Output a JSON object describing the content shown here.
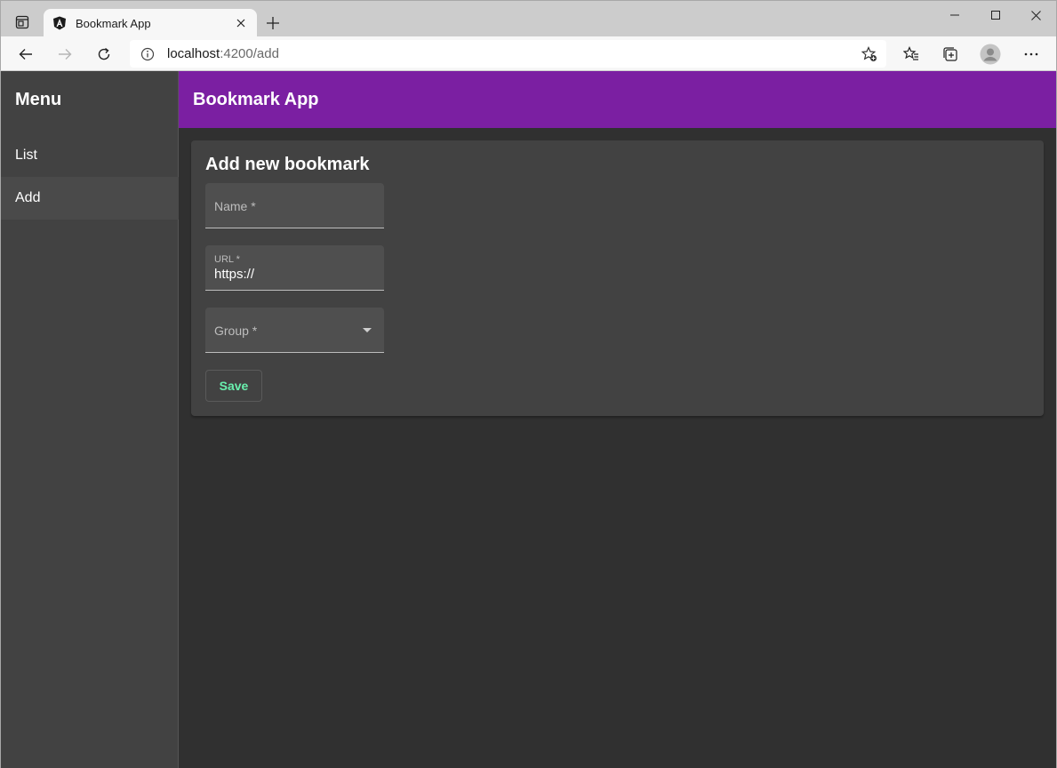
{
  "browser": {
    "tab_title": "Bookmark App",
    "url_host": "localhost",
    "url_path": ":4200/add"
  },
  "sidenav": {
    "title": "Menu",
    "items": [
      {
        "label": "List",
        "active": false
      },
      {
        "label": "Add",
        "active": true
      }
    ]
  },
  "toolbar": {
    "title": "Bookmark App"
  },
  "form": {
    "title": "Add new bookmark",
    "name_label": "Name *",
    "name_value": "",
    "url_label": "URL *",
    "url_value": "https://",
    "group_label": "Group *",
    "save_label": "Save"
  },
  "colors": {
    "toolbar": "#7b1fa2",
    "accent": "#69f0ae",
    "card": "#424242",
    "background": "#303030"
  },
  "icons": [
    "tab-actions-icon",
    "angular-icon",
    "close-icon",
    "plus-icon",
    "minimize-icon",
    "maximize-icon",
    "window-close-icon",
    "back-icon",
    "forward-icon",
    "refresh-icon",
    "info-icon",
    "add-favorite-icon",
    "favorites-icon",
    "collections-icon",
    "profile-icon",
    "more-icon",
    "chevron-down-icon"
  ]
}
